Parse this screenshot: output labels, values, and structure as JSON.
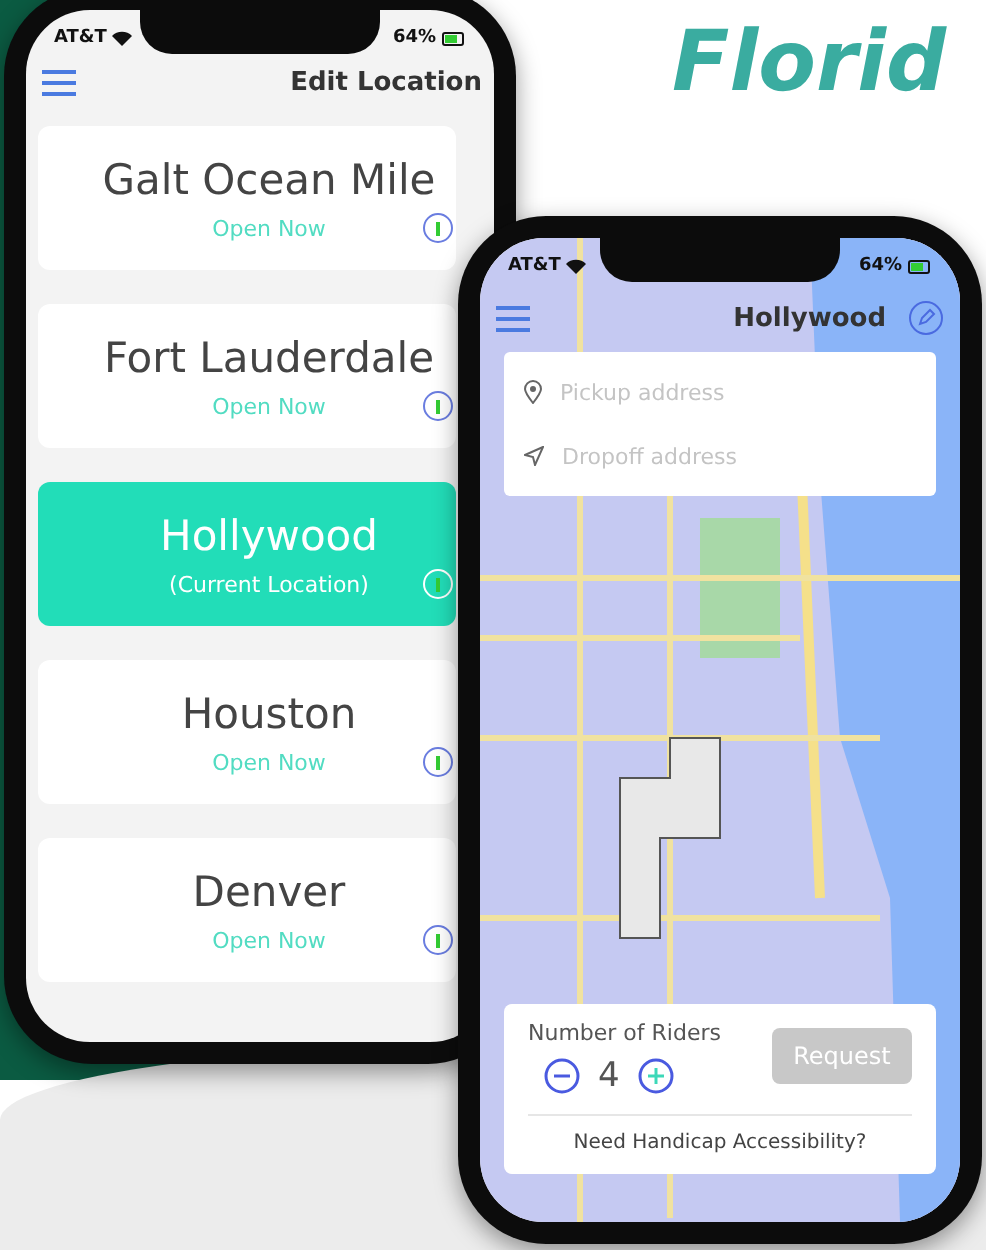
{
  "headline": "Florid",
  "left_phone": {
    "status": {
      "carrier": "AT&T",
      "battery": "64%"
    },
    "title": "Edit Location",
    "locations": [
      {
        "name": "Galt Ocean Mile",
        "status": "Open Now",
        "selected": false
      },
      {
        "name": "Fort Lauderdale",
        "status": "Open Now",
        "selected": false
      },
      {
        "name": "Hollywood",
        "status": "(Current Location)",
        "selected": true
      },
      {
        "name": "Houston",
        "status": "Open Now",
        "selected": false
      },
      {
        "name": "Denver",
        "status": "Open Now",
        "selected": false
      }
    ]
  },
  "right_phone": {
    "status": {
      "carrier": "AT&T",
      "battery": "64%"
    },
    "title": "Hollywood",
    "pickup": {
      "placeholder": "Pickup address"
    },
    "dropoff": {
      "placeholder": "Dropoff address"
    },
    "riders": {
      "label": "Number of Riders",
      "count": "4"
    },
    "request": {
      "label": "Request",
      "disabled": true
    },
    "accessibility_link": "Need Handicap Accessibility?"
  }
}
